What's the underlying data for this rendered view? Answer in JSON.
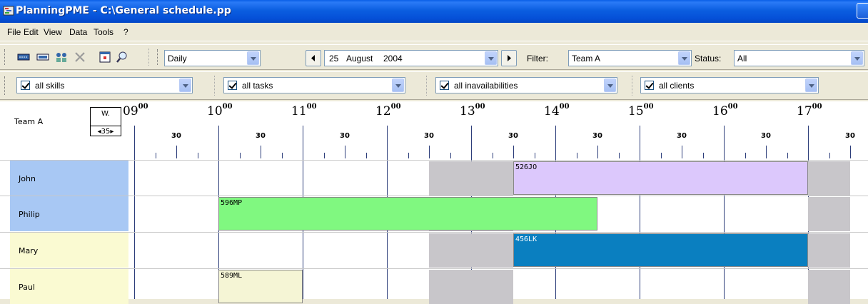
{
  "window": {
    "title": "PlanningPME - C:\\General schedule.pp"
  },
  "menu": [
    "File",
    "Edit",
    "View",
    "Data",
    "Tools",
    "?"
  ],
  "toolbar": {
    "view_mode": "Daily",
    "date_day": "25",
    "date_month": "August",
    "date_year": "2004",
    "filter_label": "Filter:",
    "filter_value": "Team A",
    "status_label": "Status:",
    "status_value": "All"
  },
  "filters": {
    "skills": "all skills",
    "tasks": "all tasks",
    "inavailabilities": "all inavailabilities",
    "clients": "all clients"
  },
  "schedule": {
    "team": "Team A",
    "week_label": "W.",
    "week_number": "35",
    "hours": [
      "09",
      "10",
      "11",
      "12",
      "13",
      "14",
      "15",
      "16",
      "17"
    ],
    "minutes_sup": "00",
    "half_label": "30",
    "rows": [
      {
        "name": "John",
        "color": "#a8c8f4",
        "tasks": [
          {
            "code": "526JO",
            "color": "#dcc8fc",
            "start_hour": 13.5,
            "end_hour": 17.0
          }
        ]
      },
      {
        "name": "Philip",
        "color": "#a8c8f4",
        "tasks": [
          {
            "code": "596MP",
            "color": "#80f880",
            "start_hour": 10.0,
            "end_hour": 14.5
          }
        ]
      },
      {
        "name": "Mary",
        "color": "#fafad2",
        "tasks": [
          {
            "code": "456LK",
            "color": "#0a7fc0",
            "start_hour": 13.5,
            "end_hour": 17.0
          }
        ]
      },
      {
        "name": "Paul",
        "color": "#fafad2",
        "tasks": [
          {
            "code": "589ML",
            "color": "#f5f5d5",
            "start_hour": 10.0,
            "end_hour": 11.0
          }
        ]
      }
    ],
    "unavailable_hours": [
      [
        12.5,
        13.5
      ],
      [
        17.0,
        17.5
      ]
    ]
  }
}
